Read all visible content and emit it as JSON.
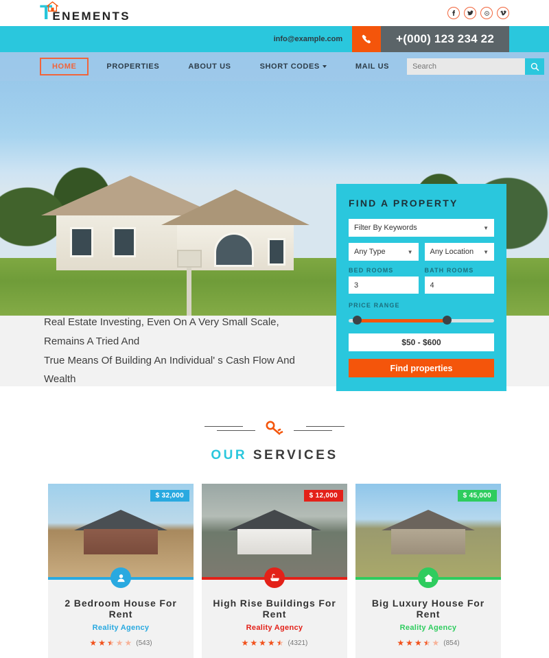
{
  "brand": {
    "logo_t": "T",
    "logo_rest": "ENEMENTS",
    "accent_orange": "#f4550b",
    "accent_teal": "#2ac7dd"
  },
  "socials": [
    {
      "name": "facebook-icon",
      "glyph": "f"
    },
    {
      "name": "twitter-icon",
      "glyph": "t"
    },
    {
      "name": "google-plus-icon",
      "glyph": "g"
    },
    {
      "name": "vimeo-icon",
      "glyph": "v"
    }
  ],
  "contact": {
    "email": "info@example.com",
    "phone": "+(000) 123 234 22"
  },
  "nav": {
    "items": [
      {
        "label": "HOME",
        "active": true,
        "dropdown": false
      },
      {
        "label": "PROPERTIES",
        "active": false,
        "dropdown": false
      },
      {
        "label": "ABOUT US",
        "active": false,
        "dropdown": false
      },
      {
        "label": "SHORT CODES",
        "active": false,
        "dropdown": true
      },
      {
        "label": "MAIL US",
        "active": false,
        "dropdown": false
      }
    ]
  },
  "search": {
    "placeholder": "Search",
    "value": ""
  },
  "find_panel": {
    "title": "FIND A PROPERTY",
    "keywords_value": "Filter By Keywords",
    "type_value": "Any Type",
    "location_value": "Any Location",
    "bedrooms_label": "BED ROOMS",
    "bedrooms_value": "3",
    "bathrooms_label": "BATH ROOMS",
    "bathrooms_value": "4",
    "price_range_label": "PRICE RANGE",
    "price_range_value": "$50 - $600",
    "submit_label": "Find properties"
  },
  "tagline": {
    "line1": "Real Estate Investing, Even On A Very Small Scale, Remains A Tried And",
    "line2": "True Means Of Building An Individual' s Cash Flow And Wealth"
  },
  "services": {
    "title_part1": "OUR",
    "title_part2": "SERVICES",
    "divider_icon": "key-icon",
    "cards": [
      {
        "price": "$ 32,000",
        "title": "2 Bedroom House For Rent",
        "agency": "Reality Agency",
        "rating": 2.5,
        "reviews": "(543)",
        "color": "#29a9e0",
        "icon": "user-icon"
      },
      {
        "price": "$ 12,000",
        "title": "High Rise Buildings For Rent",
        "agency": "Reality Agency",
        "rating": 4.5,
        "reviews": "(4321)",
        "color": "#e32119",
        "icon": "bathtub-icon"
      },
      {
        "price": "$ 45,000",
        "title": "Big Luxury House For Rent",
        "agency": "Reality Agency",
        "rating": 3.5,
        "reviews": "(854)",
        "color": "#2ecc5e",
        "icon": "home-icon"
      }
    ]
  }
}
